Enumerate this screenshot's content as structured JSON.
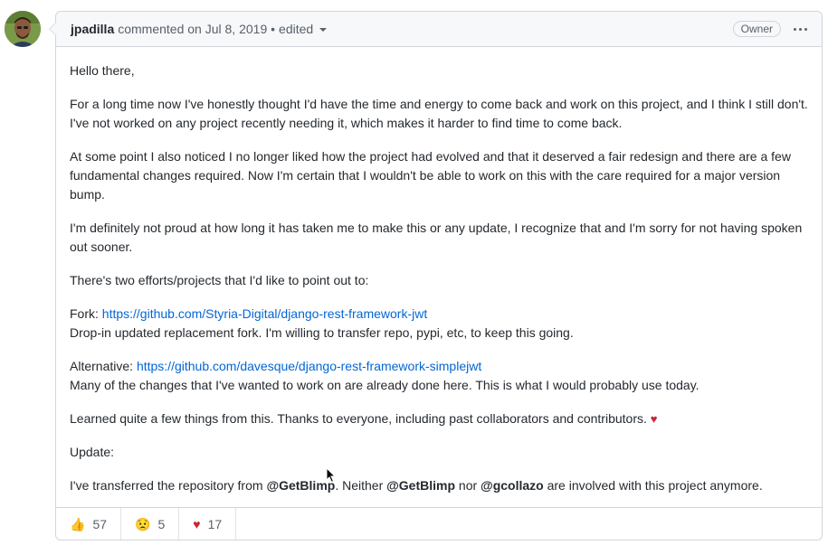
{
  "header": {
    "author": "jpadilla",
    "action": "commented on Jul 8, 2019 •",
    "edited": "edited",
    "badge": "Owner"
  },
  "body": {
    "p1": "Hello there,",
    "p2": "For a long time now I've honestly thought I'd have the time and energy to come back and work on this project, and I think I still don't. I've not worked on any project recently needing it, which makes it harder to find time to come back.",
    "p3": "At some point I also noticed I no longer liked how the project had evolved and that it deserved a fair redesign and there are a few fundamental changes required. Now I'm certain that I wouldn't be able to work on this with the care required for a major version bump.",
    "p4": "I'm definitely not proud at how long it has taken me to make this or any update, I recognize that and I'm sorry for not having spoken out sooner.",
    "p5": "There's two efforts/projects that I'd like to point out to:",
    "fork_label": "Fork: ",
    "fork_link": "https://github.com/Styria-Digital/django-rest-framework-jwt",
    "fork_desc": "Drop-in updated replacement fork. I'm willing to transfer repo, pypi, etc, to keep this going.",
    "alt_label": "Alternative: ",
    "alt_link": "https://github.com/davesque/django-rest-framework-simplejwt",
    "alt_desc": "Many of the changes that I've wanted to work on are already done here. This is what I would probably use today.",
    "p8": "Learned quite a few things from this. Thanks to everyone, including past collaborators and contributors. ",
    "heart": "♥",
    "update": "Update:",
    "p10_a": "I've transferred the repository from ",
    "mention1": "@GetBlimp",
    "p10_b": ". Neither ",
    "mention2": "@GetBlimp",
    "p10_c": " nor ",
    "mention3": "@gcollazo",
    "p10_d": " are involved with this project anymore."
  },
  "reactions": [
    {
      "icon": "thumbs-up-icon",
      "emoji": "👍",
      "count": "57"
    },
    {
      "icon": "confused-face-icon",
      "emoji": "😟",
      "count": "5"
    },
    {
      "icon": "heart-icon",
      "emoji": "♥",
      "count": "17"
    }
  ],
  "colors": {
    "link": "#0366d6",
    "heart": "#cb2431",
    "border": "#d1d5da",
    "header_bg": "#f6f8fa"
  }
}
